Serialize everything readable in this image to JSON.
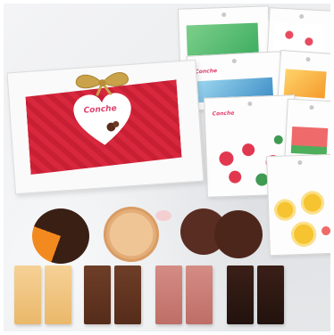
{
  "brand": "Conche",
  "colors": {
    "box_red": "#d8283e",
    "ribbon_gold": "#c9a24a",
    "brand_pink": "#e0426e",
    "dark_chocolate": "#3a1f15",
    "milk_chocolate": "#6b3b26",
    "strawberry_chocolate": "#c97b74",
    "white_chocolate": "#f2c98a",
    "biscuit": "#e8b888"
  }
}
